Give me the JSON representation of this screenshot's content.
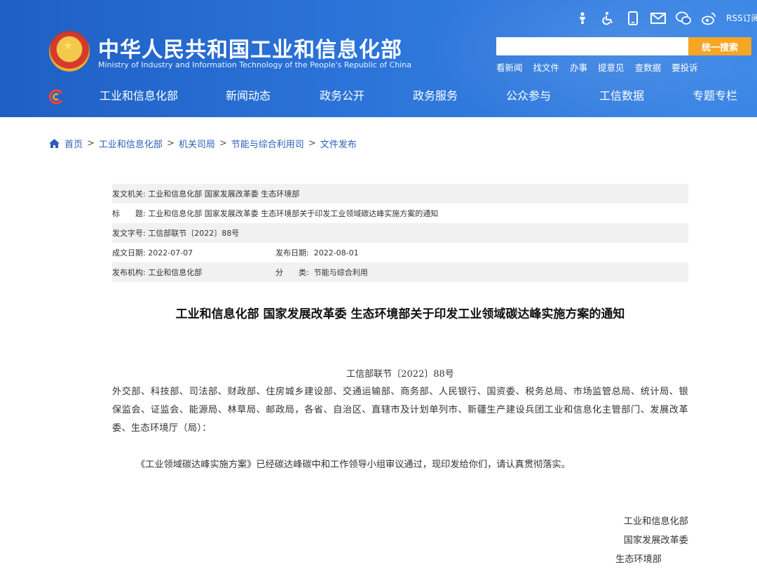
{
  "header": {
    "site_title": "中华人民共和国工业和信息化部",
    "site_subtitle": "Ministry of Industry and Information Technology of the People's Republic of China",
    "top_icons": [
      "accessibility-icon",
      "wheelchair-icon",
      "mobile-icon",
      "mail-icon",
      "wechat-icon",
      "weibo-icon"
    ],
    "rss_label": "RSS订阅",
    "search_placeholder": "",
    "search_button": "统一搜索",
    "quick_links": [
      "看新闻",
      "找文件",
      "办事",
      "提意见",
      "查数据",
      "要投诉"
    ]
  },
  "nav": {
    "items": [
      "工业和信息化部",
      "新闻动态",
      "政务公开",
      "政务服务",
      "公众参与",
      "工信数据",
      "专题专栏"
    ]
  },
  "breadcrumb": {
    "items": [
      "首页",
      "工业和信息化部",
      "机关司局",
      "节能与综合利用司",
      "文件发布"
    ],
    "separator": ">"
  },
  "meta": {
    "issuer_label": "发文机关:",
    "issuer": "工业和信息化部 国家发展改革委 生态环境部",
    "title_label": "标　　题:",
    "title": "工业和信息化部 国家发展改革委 生态环境部关于印发工业领域碳达峰实施方案的通知",
    "doc_no_label": "发文字号:",
    "doc_no": "工信部联节〔2022〕88号",
    "created_label": "成文日期:",
    "created": "2022-07-07",
    "published_label": "发布日期:",
    "published": "2022-08-01",
    "publisher_label": "发布机构:",
    "publisher": "工业和信息化部",
    "category_label": "分　　类:",
    "category": "节能与综合利用"
  },
  "document": {
    "heading": "工业和信息化部 国家发展改革委 生态环境部关于印发工业领域碳达峰实施方案的通知",
    "number": "工信部联节〔2022〕88号",
    "recipients": "外交部、科技部、司法部、财政部、住房城乡建设部、交通运输部、商务部、人民银行、国资委、税务总局、市场监管总局、统计局、银保监会、证监会、能源局、林草局、邮政局，各省、自治区、直辖市及计划单列市、新疆生产建设兵团工业和信息化主管部门、发展改革委、生态环境厅（局）：",
    "body": "《工业领域碳达峰实施方案》已经碳达峰碳中和工作领导小组审议通过，现印发给你们，请认真贯彻落实。",
    "signatures": [
      "工业和信息化部",
      "国家发展改革委",
      "生态环境部"
    ]
  },
  "colors": {
    "header_blue": "#2b73d8",
    "search_orange": "#f6a623",
    "link_blue": "#2b5fb8",
    "meta_row_gray": "#f1f1f1"
  }
}
